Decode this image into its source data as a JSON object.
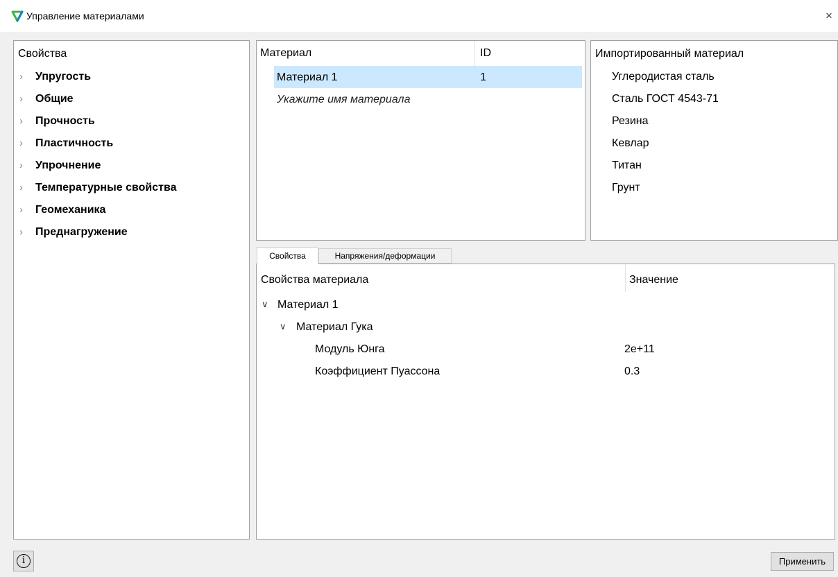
{
  "window": {
    "title": "Управление материалами",
    "close_label": "×"
  },
  "properties_panel": {
    "header": "Свойства",
    "items": [
      {
        "label": "Упругость"
      },
      {
        "label": "Общие"
      },
      {
        "label": "Прочность"
      },
      {
        "label": "Пластичность"
      },
      {
        "label": "Упрочнение"
      },
      {
        "label": "Температурные свойства"
      },
      {
        "label": "Геомеханика"
      },
      {
        "label": "Преднагружение"
      }
    ]
  },
  "materials_table": {
    "columns": [
      "Материал",
      "ID"
    ],
    "rows": [
      {
        "name": "Материал 1",
        "id": "1",
        "selected": true
      }
    ],
    "new_row_placeholder": "Укажите имя материала"
  },
  "imported_panel": {
    "header": "Импортированный материал",
    "items": [
      "Углеродистая сталь",
      "Сталь ГОСТ 4543-71",
      "Резина",
      "Кевлар",
      "Титан",
      "Грунт"
    ]
  },
  "tabs": [
    {
      "label": "Свойства",
      "active": true
    },
    {
      "label": "Напряжения/деформации",
      "active": false
    }
  ],
  "details_tree": {
    "columns": [
      "Свойства материала",
      "Значение"
    ],
    "rows": [
      {
        "label": "Материал 1",
        "value": "",
        "expanded": true
      },
      {
        "label": "Материал Гука",
        "value": "",
        "expanded": true
      },
      {
        "label": "Модуль Юнга",
        "value": "2e+11"
      },
      {
        "label": "Коэффициент Пуассона",
        "value": "0.3"
      }
    ]
  },
  "footer": {
    "info_label": "i",
    "apply_label": "Применить"
  },
  "colors": {
    "selection": "#cce8ff",
    "logo_green": "#3bb54a",
    "logo_blue": "#1b7fc4"
  },
  "icons": [
    "app-logo-icon",
    "close-icon",
    "chevron-right-icon",
    "chevron-down-icon",
    "info-icon"
  ]
}
